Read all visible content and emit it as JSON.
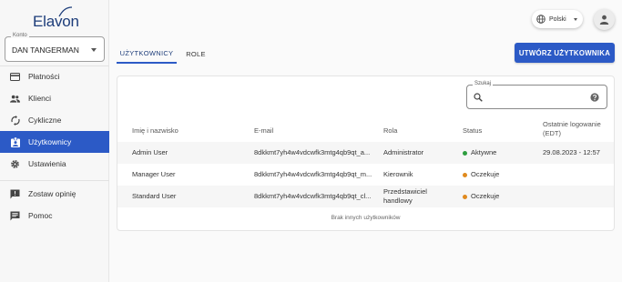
{
  "brand": {
    "logo_text": "Elavon"
  },
  "account": {
    "legend": "Konto",
    "value": "DAN TANGERMAN"
  },
  "sidebar": {
    "items": [
      {
        "label": "Płatności",
        "icon": "credit-card-icon",
        "active": false
      },
      {
        "label": "Klienci",
        "icon": "people-icon",
        "active": false
      },
      {
        "label": "Cykliczne",
        "icon": "sync-icon",
        "active": false
      },
      {
        "label": "Użytkownicy",
        "icon": "badge-icon",
        "active": true
      },
      {
        "label": "Ustawienia",
        "icon": "gear-icon",
        "active": false
      },
      {
        "label": "Zostaw opinię",
        "icon": "feedback-icon",
        "active": false
      },
      {
        "label": "Pomoc",
        "icon": "help-chat-icon",
        "active": false
      }
    ]
  },
  "header": {
    "language": "Polski"
  },
  "tabs": [
    {
      "label": "UŻYTKOWNICY",
      "active": true
    },
    {
      "label": "ROLE",
      "active": false
    }
  ],
  "actions": {
    "create_user": "UTWÓRZ UŻYTKOWNIKA"
  },
  "search": {
    "legend": "Szukaj",
    "value": "",
    "placeholder": ""
  },
  "table": {
    "columns": [
      "Imię i nazwisko",
      "E-mail",
      "Rola",
      "Status",
      "Ostatnie logowanie (EDT)"
    ],
    "rows": [
      {
        "name": "Admin User",
        "email": "8dkkmt7yh4w4vdcwfk3mtg4qb9qt_a...",
        "role": "Administrator",
        "status": "Aktywne",
        "last_login": "29.08.2023 - 12:57"
      },
      {
        "name": "Manager User",
        "email": "8dkkmt7yh4w4vdcwfk3mtg4qb9qt_m...",
        "role": "Kierownik",
        "status": "Oczekuje",
        "last_login": ""
      },
      {
        "name": "Standard User",
        "email": "8dkkmt7yh4w4vdcwfk3mtg4qb9qt_cl...",
        "role": "Przedstawiciel handlowy",
        "status": "Oczekuje",
        "last_login": ""
      }
    ],
    "empty_note": "Brak innych użytkowników"
  },
  "colors": {
    "primary": "#2c5ac6",
    "active_status": "#2e9e3f",
    "pending_status": "#e08a1e"
  }
}
